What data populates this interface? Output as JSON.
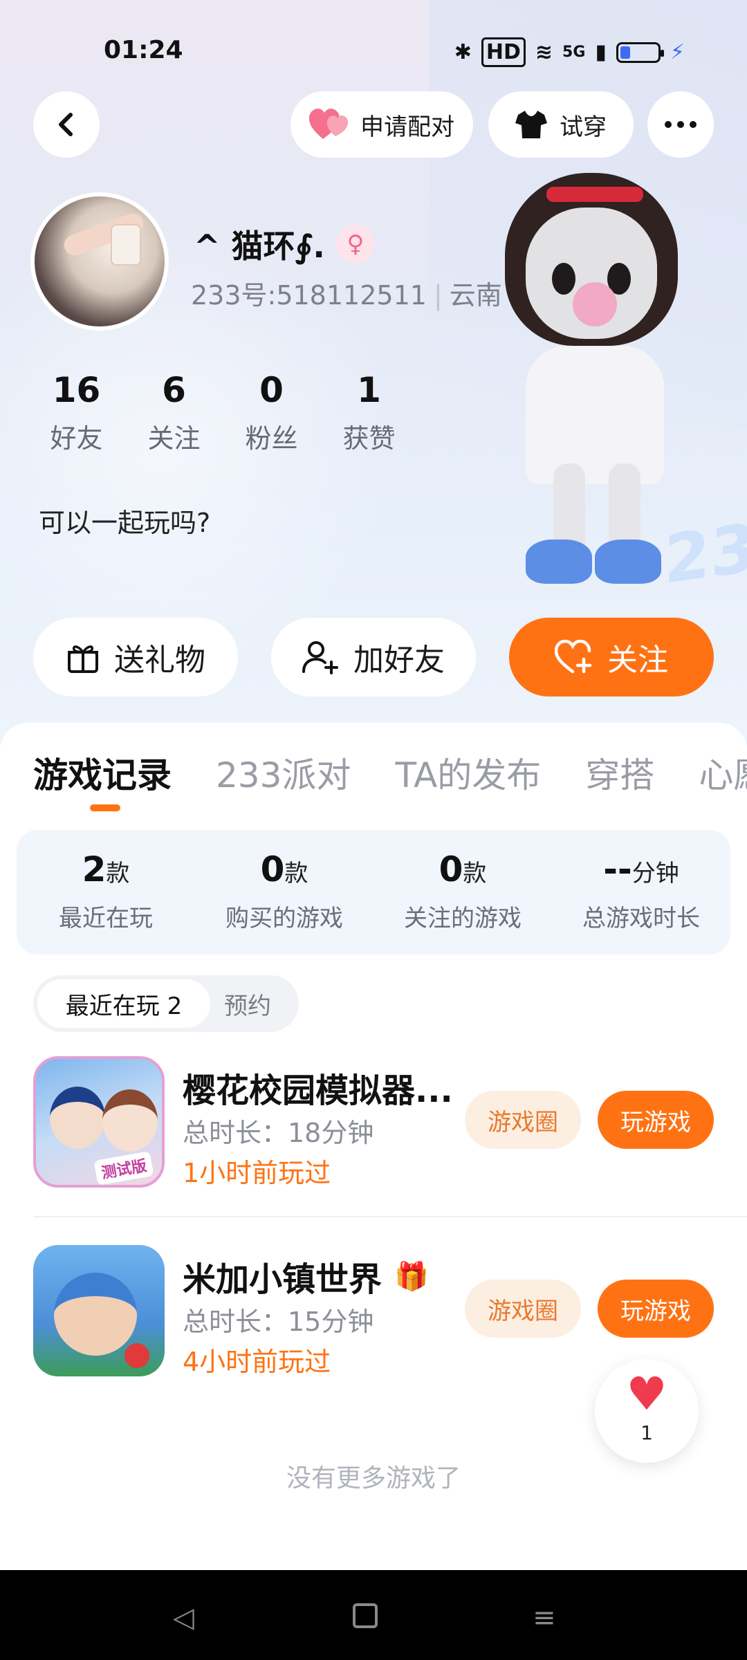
{
  "status": {
    "time": "01:24",
    "network": "5G",
    "hd": "HD"
  },
  "top": {
    "match_label": "申请配对",
    "try_label": "试穿"
  },
  "profile": {
    "nickname": "^ 猫环∮.",
    "uid": "233号:518112511",
    "region": "云南",
    "bio": "可以一起玩吗?"
  },
  "stats": [
    {
      "num": "16",
      "label": "好友"
    },
    {
      "num": "6",
      "label": "关注"
    },
    {
      "num": "0",
      "label": "粉丝"
    },
    {
      "num": "1",
      "label": "获赞"
    }
  ],
  "actions": {
    "gift": "送礼物",
    "add_friend": "加好友",
    "follow": "关注"
  },
  "tabs": [
    "游戏记录",
    "233派对",
    "TA的发布",
    "穿搭",
    "心愿"
  ],
  "summary": [
    {
      "value": "2",
      "unit": "款",
      "label": "最近在玩"
    },
    {
      "value": "0",
      "unit": "款",
      "label": "购买的游戏"
    },
    {
      "value": "0",
      "unit": "款",
      "label": "关注的游戏"
    },
    {
      "value": "--",
      "unit": "分钟",
      "label": "总游戏时长"
    }
  ],
  "filter": {
    "recent": "最近在玩 2",
    "reserve": "预约"
  },
  "games": [
    {
      "name": "樱花校园模拟器...",
      "duration": "总时长：18分钟",
      "last": "1小时前玩过",
      "icon_tag": "测试版"
    },
    {
      "name": "米加小镇世界",
      "duration": "总时长：15分钟",
      "last": "4小时前玩过"
    }
  ],
  "game_buttons": {
    "circle": "游戏圈",
    "play": "玩游戏"
  },
  "like": {
    "count": "1"
  },
  "footer": {
    "no_more": "没有更多游戏了"
  },
  "colors": {
    "accent": "#ff7213",
    "pink": "#f0668e"
  }
}
